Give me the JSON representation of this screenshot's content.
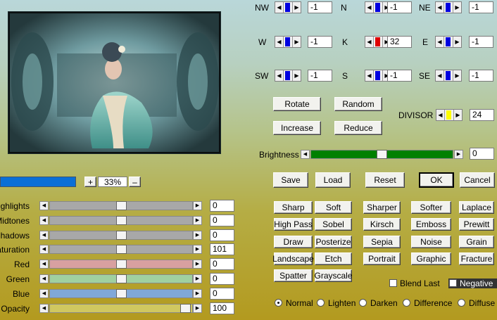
{
  "compass": {
    "nw": {
      "label": "NW",
      "value": "-1"
    },
    "n": {
      "label": "N",
      "value": "-1"
    },
    "ne": {
      "label": "NE",
      "value": "-1"
    },
    "w": {
      "label": "W",
      "value": "-1"
    },
    "k": {
      "label": "K",
      "value": "32"
    },
    "e": {
      "label": "E",
      "value": "-1"
    },
    "sw": {
      "label": "SW",
      "value": "-1"
    },
    "s": {
      "label": "S",
      "value": "-1"
    },
    "se": {
      "label": "SE",
      "value": "-1"
    }
  },
  "buttons": {
    "rotate": "Rotate",
    "random": "Random",
    "increase": "Increase",
    "reduce": "Reduce",
    "save": "Save",
    "load": "Load",
    "reset": "Reset",
    "ok": "OK",
    "cancel": "Cancel"
  },
  "divisor": {
    "label": "DIVISOR",
    "value": "24"
  },
  "brightness": {
    "label": "Brightness",
    "value": "0"
  },
  "zoom": {
    "value": "33%",
    "plus": "+",
    "minus": "–"
  },
  "adjustments": [
    {
      "label": "Highlights",
      "value": "0"
    },
    {
      "label": "Midtones",
      "value": "0"
    },
    {
      "label": "Shadows",
      "value": "0"
    },
    {
      "label": "aturation",
      "value": "101"
    },
    {
      "label": "Red",
      "value": "0"
    },
    {
      "label": "Green",
      "value": "0"
    },
    {
      "label": "Blue",
      "value": "0"
    },
    {
      "label": "Opacity",
      "value": "100"
    }
  ],
  "filters": [
    "Sharp",
    "Soft",
    "Sharper",
    "Softer",
    "Laplace",
    "High Pass",
    "Sobel",
    "Kirsch",
    "Emboss",
    "Prewitt",
    "Draw",
    "Posterize",
    "Sepia",
    "Noise",
    "Grain",
    "Landscape",
    "Etch",
    "Portrait",
    "Graphic",
    "Fracture",
    "Spatter",
    "Grayscale"
  ],
  "checks": {
    "blend_last": "Blend Last",
    "negative": "Negative"
  },
  "blend_modes": {
    "selected": "Normal",
    "options": [
      "Normal",
      "Lighten",
      "Darken",
      "Difference",
      "Diffuse"
    ]
  },
  "colors": {
    "blue_marker": "#0000e0",
    "red_marker": "#e00000",
    "yellow_marker": "#ffff00",
    "brightness_fill": "#008000",
    "progress": "#0a6fd6"
  }
}
